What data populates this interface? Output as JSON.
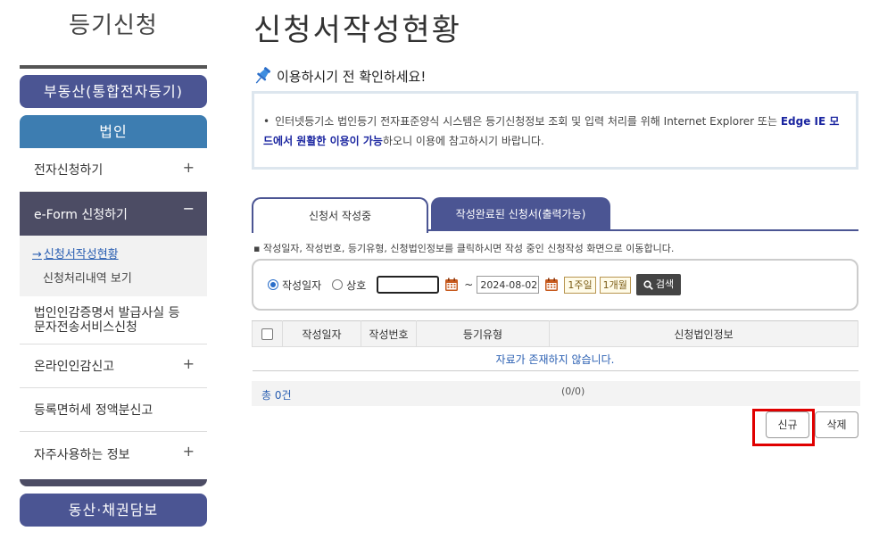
{
  "sidebar": {
    "title": "등기신청",
    "realty_button": "부동산(통합전자등기)",
    "corp_button": "법인",
    "items": [
      {
        "label": "전자신청하기",
        "toggle": "+"
      },
      {
        "label": "e-Form 신청하기",
        "toggle": "−"
      },
      {
        "label": "법인인감증명서 발급사실 등 문자전송서비스신청"
      },
      {
        "label": "온라인인감신고",
        "toggle": "+"
      },
      {
        "label": "등록면허세 정액분신고"
      },
      {
        "label": "자주사용하는 정보",
        "toggle": "+"
      }
    ],
    "sub_items": {
      "active": "신청서작성현황",
      "other": "신청처리내역 보기"
    },
    "movable_button": "동산·채권담보"
  },
  "main": {
    "title": "신청서작성현황",
    "notice_heading": "이용하시기 전 확인하세요!",
    "notice": {
      "bullet": "•",
      "text_before": "인터넷등기소 법인등기 전자표준양식 시스템은 등기신청정보 조회 및 입력 처리를 위해 Internet Explorer 또는 ",
      "highlight": "Edge IE 모드에서 원활한 이용이 가능",
      "text_after": "하오니 이용에 참고하시기 바랍니다."
    },
    "tabs": [
      {
        "label": "신청서 작성중",
        "active": true
      },
      {
        "label": "작성완료된 신청서(출력가능)",
        "active": false
      }
    ],
    "hint": "▪ 작성일자, 작성번호, 등기유형, 신청법인정보를 클릭하시면 작성 중인 신청작성 화면으로 이동합니다.",
    "search": {
      "radio_date": "작성일자",
      "radio_name": "상호",
      "from_value": "",
      "to_value": "2024-08-02",
      "tilde": "~",
      "week_btn": "1주일",
      "month_btn": "1개월",
      "search_btn": "검색"
    },
    "table": {
      "headers": [
        "작성일자",
        "작성번호",
        "등기유형",
        "신청법인정보"
      ],
      "empty_text": "자료가 존재하지 않습니다."
    },
    "total": "총 0건",
    "pager": "(0/0)",
    "new_btn": "신규",
    "delete_btn": "삭제"
  },
  "colors": {
    "navy": "#4b5593",
    "corp_blue": "#3d7db1",
    "highlight_red": "#e00000"
  }
}
